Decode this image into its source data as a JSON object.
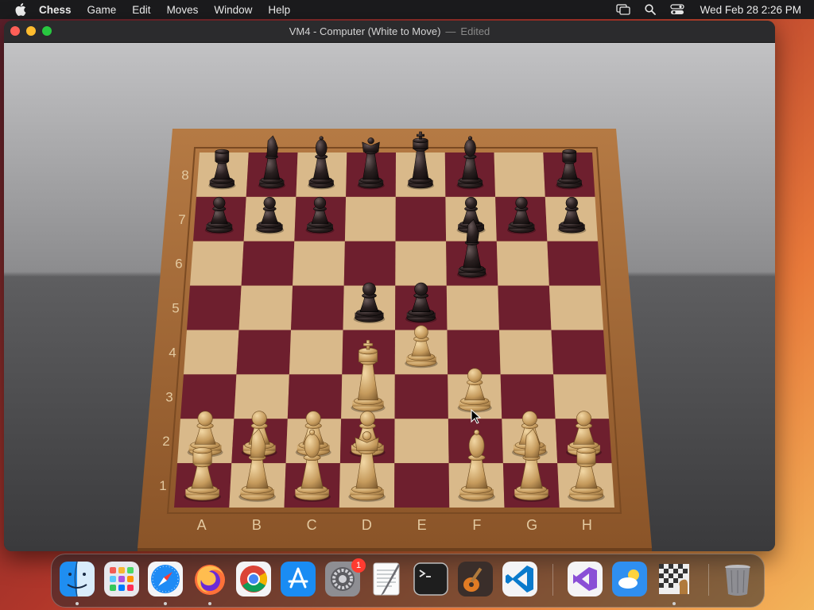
{
  "menubar": {
    "app_name": "Chess",
    "items": [
      "Game",
      "Edit",
      "Moves",
      "Window",
      "Help"
    ],
    "clock": "Wed Feb 28  2:26 PM"
  },
  "window": {
    "title": "VM4 - Computer   (White to Move)",
    "separator": "—",
    "status": "Edited"
  },
  "board": {
    "files": [
      "A",
      "B",
      "C",
      "D",
      "E",
      "F",
      "G",
      "H"
    ],
    "ranks": [
      "8",
      "7",
      "6",
      "5",
      "4",
      "3",
      "2",
      "1"
    ],
    "light_square": "#d9b98a",
    "dark_square": "#6e1f2e",
    "frame": "#a86a38",
    "pieces": [
      {
        "color": "black",
        "type": "rook",
        "square": "a8"
      },
      {
        "color": "black",
        "type": "knight",
        "square": "b8"
      },
      {
        "color": "black",
        "type": "bishop",
        "square": "c8"
      },
      {
        "color": "black",
        "type": "queen",
        "square": "d8"
      },
      {
        "color": "black",
        "type": "king",
        "square": "e8"
      },
      {
        "color": "black",
        "type": "bishop",
        "square": "f8"
      },
      {
        "color": "black",
        "type": "rook",
        "square": "h8"
      },
      {
        "color": "black",
        "type": "pawn",
        "square": "a7"
      },
      {
        "color": "black",
        "type": "pawn",
        "square": "b7"
      },
      {
        "color": "black",
        "type": "pawn",
        "square": "c7"
      },
      {
        "color": "black",
        "type": "pawn",
        "square": "f7"
      },
      {
        "color": "black",
        "type": "pawn",
        "square": "g7"
      },
      {
        "color": "black",
        "type": "pawn",
        "square": "h7"
      },
      {
        "color": "black",
        "type": "knight",
        "square": "f6"
      },
      {
        "color": "black",
        "type": "pawn",
        "square": "d5"
      },
      {
        "color": "black",
        "type": "pawn",
        "square": "e5"
      },
      {
        "color": "white",
        "type": "pawn",
        "square": "e4"
      },
      {
        "color": "white",
        "type": "king",
        "square": "d3"
      },
      {
        "color": "white",
        "type": "pawn",
        "square": "f3"
      },
      {
        "color": "white",
        "type": "pawn",
        "square": "a2"
      },
      {
        "color": "white",
        "type": "pawn",
        "square": "b2"
      },
      {
        "color": "white",
        "type": "pawn",
        "square": "c2"
      },
      {
        "color": "white",
        "type": "pawn",
        "square": "d2"
      },
      {
        "color": "white",
        "type": "pawn",
        "square": "g2"
      },
      {
        "color": "white",
        "type": "pawn",
        "square": "h2"
      },
      {
        "color": "white",
        "type": "rook",
        "square": "a1"
      },
      {
        "color": "white",
        "type": "knight",
        "square": "b1"
      },
      {
        "color": "white",
        "type": "bishop",
        "square": "c1"
      },
      {
        "color": "white",
        "type": "queen",
        "square": "d1"
      },
      {
        "color": "white",
        "type": "bishop",
        "square": "f1"
      },
      {
        "color": "white",
        "type": "knight",
        "square": "g1"
      },
      {
        "color": "white",
        "type": "rook",
        "square": "h1"
      }
    ]
  },
  "dock": {
    "items": [
      {
        "name": "finder-icon",
        "running": true
      },
      {
        "name": "launchpad-icon",
        "running": false
      },
      {
        "name": "safari-icon",
        "running": true
      },
      {
        "name": "firefox-icon",
        "running": true
      },
      {
        "name": "chrome-icon",
        "running": false
      },
      {
        "name": "app-store-icon",
        "running": false
      },
      {
        "name": "system-settings-icon",
        "running": false,
        "badge": "1"
      },
      {
        "name": "textedit-icon",
        "running": false
      },
      {
        "name": "terminal-icon",
        "running": false
      },
      {
        "name": "garageband-icon",
        "running": false
      },
      {
        "name": "vscode-icon",
        "running": false
      },
      {
        "name": "visual-studio-icon",
        "running": false
      },
      {
        "name": "weather-icon",
        "running": false
      },
      {
        "name": "chess-icon",
        "running": true
      },
      {
        "name": "trash-icon",
        "running": false
      }
    ]
  }
}
